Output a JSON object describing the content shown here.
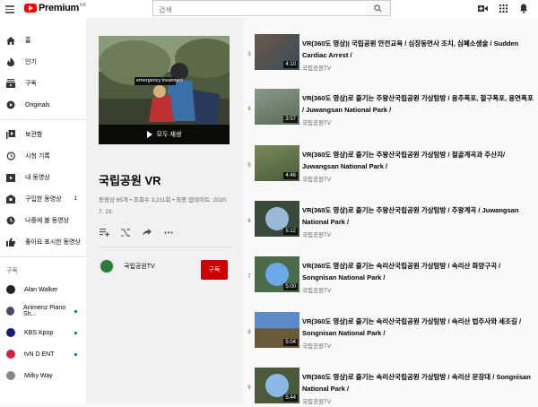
{
  "header": {
    "logo_text": "Premium",
    "logo_region": "KR",
    "search_placeholder": "검색"
  },
  "sidebar": {
    "main": [
      {
        "label": "홈",
        "icon": "home-icon"
      },
      {
        "label": "인기",
        "icon": "trending-icon"
      },
      {
        "label": "구독",
        "icon": "subscriptions-icon"
      },
      {
        "label": "Originals",
        "icon": "originals-icon"
      }
    ],
    "library": [
      {
        "label": "보관함",
        "icon": "library-icon"
      },
      {
        "label": "시청 기록",
        "icon": "history-icon"
      },
      {
        "label": "내 동영상",
        "icon": "my-videos-icon"
      },
      {
        "label": "구입한 동영상",
        "icon": "purchases-icon",
        "count": "1"
      },
      {
        "label": "나중에 볼 동영상",
        "icon": "watch-later-icon"
      },
      {
        "label": "좋아요 표시한 동영상",
        "icon": "like-icon"
      }
    ],
    "subscriptions_heading": "구독",
    "subscriptions": [
      {
        "label": "Alan Walker",
        "color": "#222222"
      },
      {
        "label": "Animenz Piano Sh...",
        "color": "#4a4a6a",
        "dot": true
      },
      {
        "label": "KBS Kpop",
        "color": "#1a1a7a",
        "dot": true
      },
      {
        "label": "tvN D ENT",
        "color": "#d62040",
        "dot": true
      },
      {
        "label": "Milky Way",
        "color": "#888888"
      }
    ]
  },
  "playlist": {
    "title": "국립공원 VR",
    "play_all": "모두 재생",
    "thumb_caption": "emergency treatment",
    "meta": "동영상 65개 • 조회수 3,211회 • 최종 업데이트: 2020. 7. 23.",
    "owner": "국립공원TV",
    "subscribe_label": "구독"
  },
  "videos": [
    {
      "index": "3",
      "title": "VR(360도 영상)| 국립공원 안전교육 / 심장동연사 조치, 심폐소생술 / Sudden Cardiac Arrest /",
      "channel": "국립공원TV",
      "duration": "4:10"
    },
    {
      "index": "4",
      "title": "VR(360도 영상)로 즐기는 주왕산국립공원 가상탐방 / 용추폭포, 절구폭포, 용연폭포 / Juwangsan National Park /",
      "channel": "국립공원TV",
      "duration": "3:57"
    },
    {
      "index": "5",
      "title": "VR(360도 영상)로 즐기는 주왕산국립공원 가상탐방 / 절골계곡과 주산지/ Juwangsan National Park /",
      "channel": "국립공원TV",
      "duration": "4:46"
    },
    {
      "index": "6",
      "title": "VR(360도 영상)로 즐기는 주왕산국립공원 가상탐방 / 주왕계곡 / Juwangsan National Park /",
      "channel": "국립공원TV",
      "duration": "5:12"
    },
    {
      "index": "7",
      "title": "VR(360도 영상)로 즐기는 속리산국립공원 가상탐방 / 속리산 화양구곡 / Songnisan National Park /",
      "channel": "국립공원TV",
      "duration": "5:00"
    },
    {
      "index": "8",
      "title": "VR(360도 영상)로 즐기는 속리산국립공원 가상탐방 / 속리산 법주사와 세조길 / Songnisan National Park /",
      "channel": "국립공원TV",
      "duration": "5:04"
    },
    {
      "index": "9",
      "title": "VR(360도 영상)로 즐기는 속리산국립공원 가상탐방 / 속리산 문장대 / Songnisan National Park /",
      "channel": "국립공원TV",
      "duration": "5:44"
    }
  ],
  "colors": {
    "brand_red": "#ff0000",
    "subscribe_red": "#cc0000",
    "link_blue": "#065fd4"
  }
}
